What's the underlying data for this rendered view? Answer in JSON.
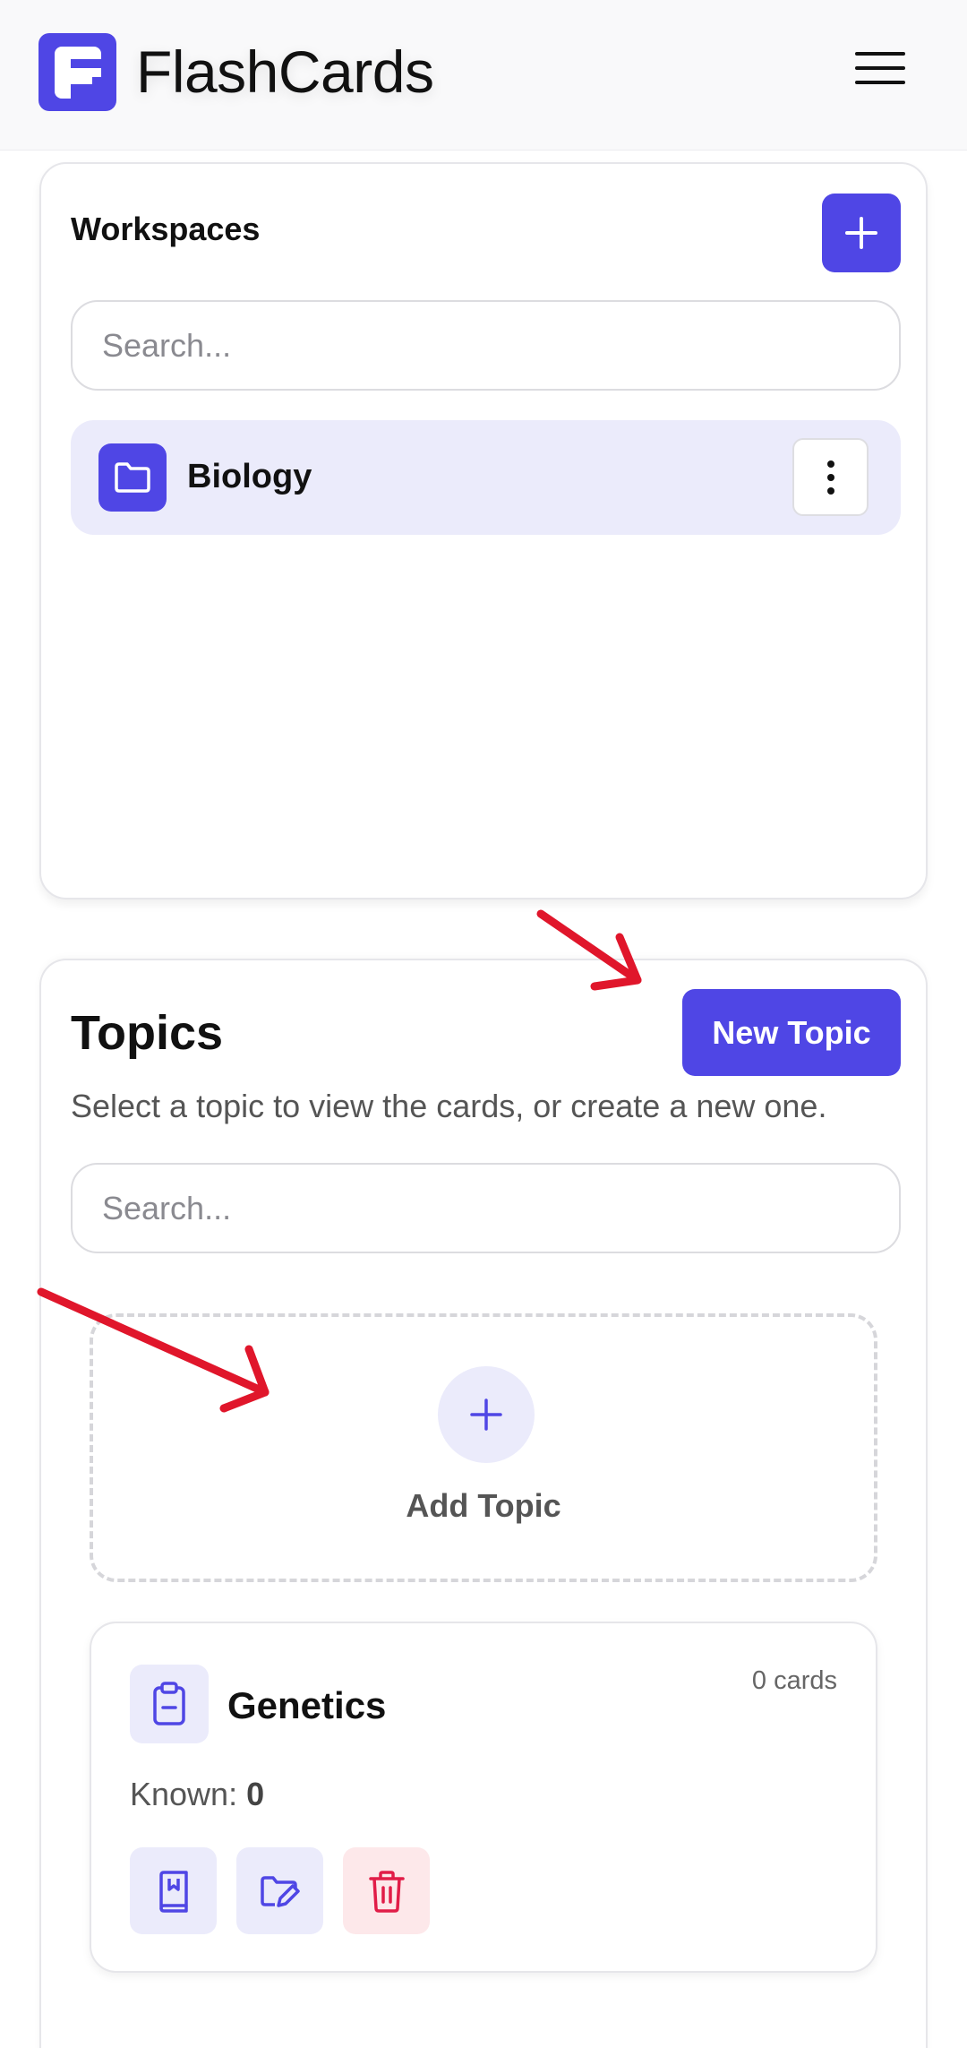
{
  "header": {
    "logo_letter": "F",
    "app_title": "FlashCards",
    "menu_icon": "hamburger-menu-icon"
  },
  "workspaces": {
    "title": "Workspaces",
    "add_icon": "plus-icon",
    "search_placeholder": "Search...",
    "items": [
      {
        "name": "Biology",
        "icon": "folder-icon",
        "more_icon": "vertical-ellipsis-icon"
      }
    ]
  },
  "topics": {
    "title": "Topics",
    "new_topic_label": "New Topic",
    "subtitle": "Select a topic to view the cards, or create a new one.",
    "search_placeholder": "Search...",
    "add_topic_label": "Add Topic",
    "cards": [
      {
        "name": "Genetics",
        "icon": "clipboard-icon",
        "count_label": "0 cards",
        "known_label": "Known:",
        "known_value": "0",
        "actions": [
          "study-book-icon",
          "edit-folder-icon",
          "trash-icon"
        ]
      }
    ]
  },
  "colors": {
    "accent": "#4f46e5",
    "accent_soft": "#ebebfb",
    "danger": "#e11d48",
    "danger_soft": "#fde8ea",
    "annotation_arrow": "#e0162b"
  }
}
